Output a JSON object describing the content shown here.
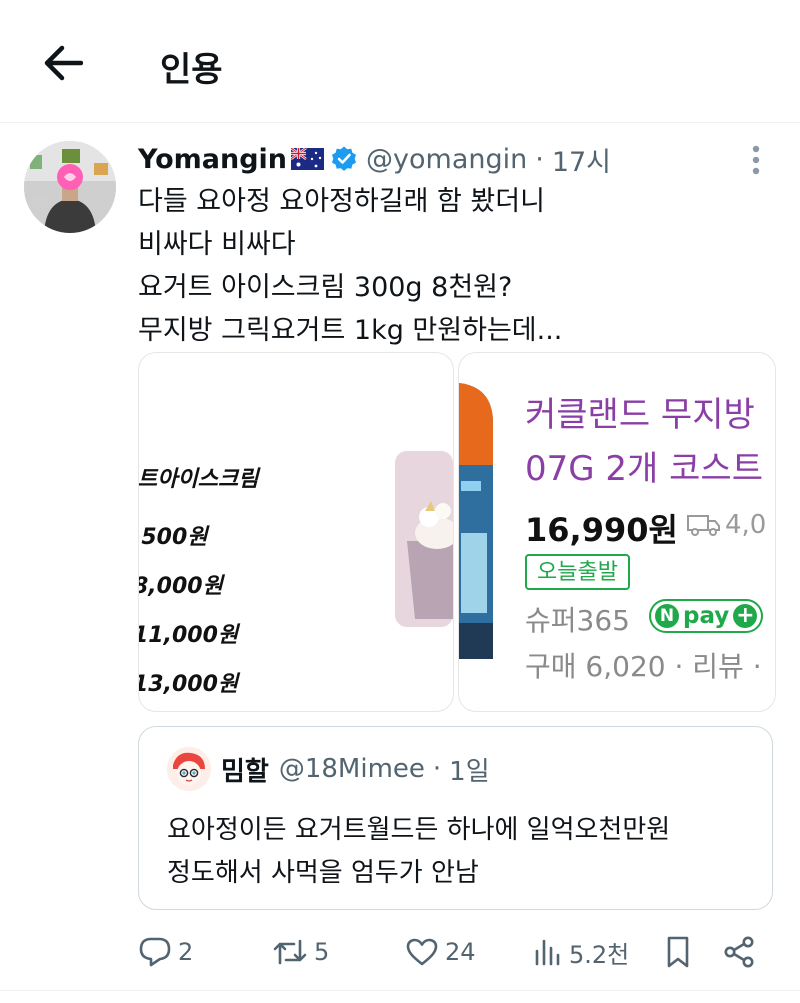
{
  "header": {
    "title": "인용"
  },
  "tweet": {
    "name": "Yomangin",
    "handle": "@yomangin",
    "separator": "·",
    "time": "17시",
    "lines": [
      "다들 요아정 요아정하길래 함 봤더니",
      "비싸다 비싸다",
      "요거트 아이스크림 300g 8천원?",
      "무지방 그릭요거트 1kg 만원하는데..."
    ]
  },
  "media_left": {
    "heading": "트아이스크림",
    "prices": [
      ",500원",
      "8,000원",
      "11,000원",
      "13,000원"
    ]
  },
  "media_right": {
    "title_line1": "커클랜드 무지방",
    "title_line2": "07G 2개 코스트",
    "price": "16,990원",
    "shipping": "4,0",
    "badge": "오늘출발",
    "store": "슈퍼365",
    "npay_n": "N",
    "npay_label": "pay",
    "npay_plus": "+",
    "purchase": "구매 6,020 · 리뷰 ·"
  },
  "quote": {
    "name": "밈할",
    "handle": "@18Mimee",
    "separator": "·",
    "time": "1일",
    "lines": [
      "요아정이든 요거트월드든 하나에 일억오천만원",
      "정도해서 사먹을 엄두가 안남"
    ]
  },
  "actions": {
    "replies": "2",
    "retweets": "5",
    "likes": "24",
    "views": "5.2천"
  },
  "colors": {
    "text": "#0f1419",
    "secondary": "#536471",
    "verified": "#1d9bf0",
    "border": "#cfd9de",
    "naver_green": "#1fa94a",
    "product_purple": "#8a3ea6"
  }
}
